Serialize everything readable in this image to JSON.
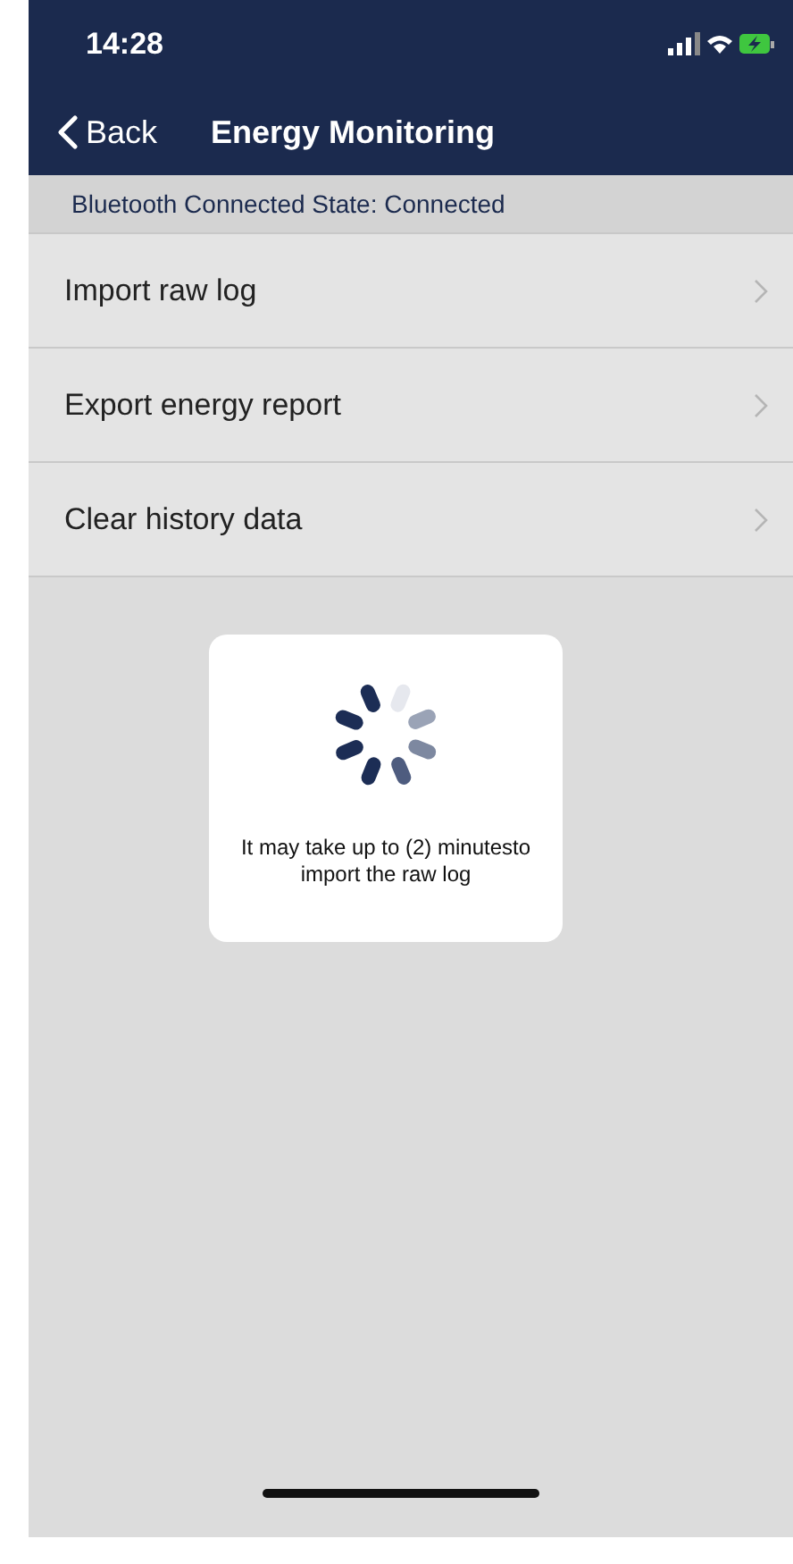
{
  "status_bar": {
    "time": "14:28"
  },
  "nav": {
    "back": "Back",
    "title": "Energy Monitoring"
  },
  "connection": {
    "text": "Bluetooth Connected State: Connected"
  },
  "menu": [
    {
      "label": "Import raw log"
    },
    {
      "label": "Export energy report"
    },
    {
      "label": "Clear history data"
    }
  ],
  "loading": {
    "message": "It may take up to (2) minutesto import the raw log"
  }
}
